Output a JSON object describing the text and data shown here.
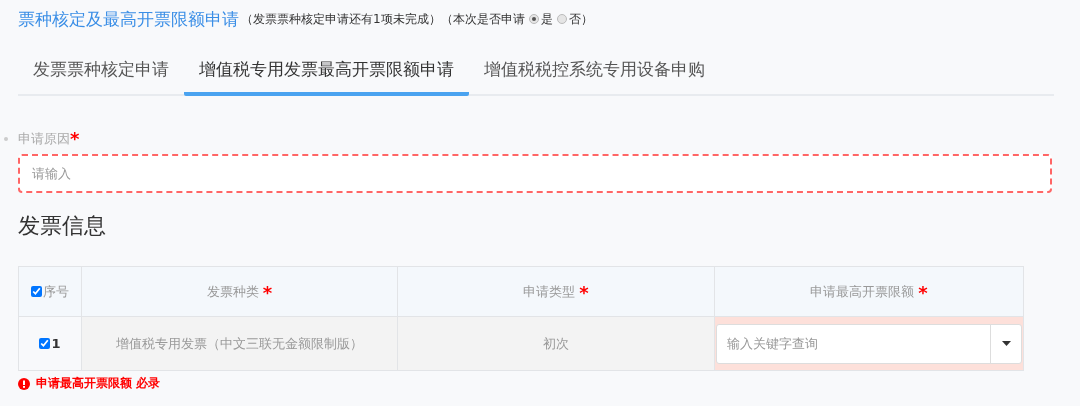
{
  "header": {
    "title": "票种核定及最高开票限额申请",
    "note": "（发票票种核定申请还有1项未完成）（",
    "question": "本次是否申请",
    "options": [
      {
        "label": "是",
        "selected": true
      },
      {
        "label": "否",
        "selected": false
      }
    ],
    "close": "）"
  },
  "tabs": [
    {
      "label": "发票票种核定申请",
      "selected": false
    },
    {
      "label": "增值税专用发票最高开票限额申请",
      "selected": true
    },
    {
      "label": "增值税税控系统专用设备申购",
      "selected": false
    }
  ],
  "reason": {
    "label": "申请原因",
    "required_mark": "*",
    "placeholder": "请输入",
    "invalid": true
  },
  "section_title": "发票信息",
  "table": {
    "select_all": {
      "checked": true,
      "label": "序号"
    },
    "columns": [
      {
        "label": "发票种类",
        "required_mark": "*"
      },
      {
        "label": "申请类型",
        "required_mark": "*"
      },
      {
        "label": "申请最高开票限额",
        "required_mark": "*"
      }
    ],
    "rows": [
      {
        "checked": true,
        "index": "1",
        "invoice_type": "增值税专用发票（中文三联无金额限制版）",
        "apply_type": "初次",
        "limit": {
          "placeholder": "输入关键字查询",
          "invalid": true
        }
      }
    ]
  },
  "error": "申请最高开票限额 必录"
}
